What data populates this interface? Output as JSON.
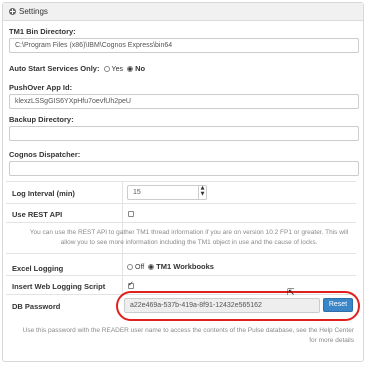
{
  "panel": {
    "title": "Settings"
  },
  "tm1_bin": {
    "label": "TM1 Bin Directory:",
    "value": "C:\\Program Files (x86)\\IBM\\Cognos Express\\bin64"
  },
  "auto_start": {
    "label": "Auto Start Services Only:",
    "yes": "Yes",
    "no": "No",
    "selected": "No"
  },
  "pushover": {
    "label": "PushOver App Id:",
    "value": "klexzLSSgGIS6YXpHfu7oevfUh2peU"
  },
  "backup": {
    "label": "Backup Directory:",
    "value": ""
  },
  "cognos": {
    "label": "Cognos Dispatcher:",
    "value": ""
  },
  "log_interval": {
    "label": "Log Interval (min)",
    "value": "15"
  },
  "rest_api": {
    "label": "Use REST API",
    "checked": false,
    "help": "You can use the REST API to gather TM1 thread information if you are on version 10.2 FP1 or greater. This will allow you to see more information including the TM1 object in use and the cause of locks."
  },
  "excel_logging": {
    "label": "Excel Logging",
    "off": "Off",
    "tm1": "TM1 Workbooks",
    "selected": "TM1 Workbooks"
  },
  "web_logging": {
    "label": "Insert Web Logging Script",
    "checked": true
  },
  "db_password": {
    "label": "DB Password",
    "value": "a22e469a-537b-419a-8f91-12432e565162",
    "reset_label": "Reset",
    "help": "Use this password with the READER user name to access the contents of the Pulse database, see the Help Center for more details"
  },
  "colors": {
    "accent": "#3a86c8",
    "highlight_ring": "#e0201e"
  }
}
